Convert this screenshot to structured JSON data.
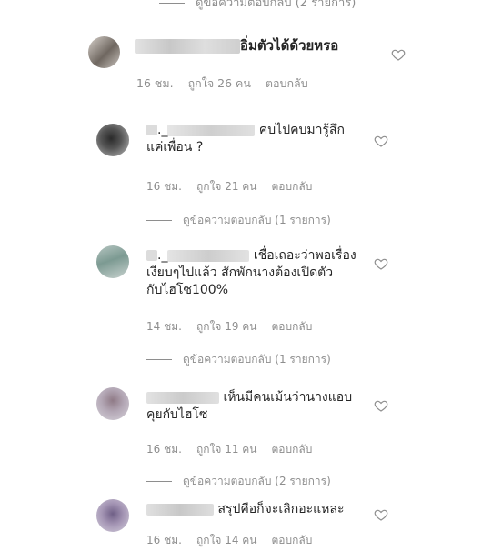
{
  "top_replies": "ดูข้อความตอบกลับ (2 รายการ)",
  "main_comment": {
    "text": "อิ่มตัวได้ด้วยหรอ",
    "time": "16 ชม.",
    "likes": "ถูกใจ 26 คน",
    "reply": "ตอบกลับ"
  },
  "comments": [
    {
      "prefix": "._",
      "text_1": " คบไปคบมารู้สึก",
      "text_2": "แค่เพื่อน ?",
      "text_3": "",
      "time": "16 ชม.",
      "likes": "ถูกใจ 21 คน",
      "reply": "ตอบกลับ",
      "view_replies": "ดูข้อความตอบกลับ (1 รายการ)"
    },
    {
      "prefix": "._",
      "text_1": " เชื่อเถอะว่าพอเรื่อง",
      "text_2": "เงียบๆไปแล้ว สักพักนางต้องเปิดตัว",
      "text_3": "กับไฮโซ100%",
      "time": "14 ชม.",
      "likes": "ถูกใจ 19 คน",
      "reply": "ตอบกลับ",
      "view_replies": "ดูข้อความตอบกลับ (1 รายการ)"
    },
    {
      "prefix": "",
      "text_1": " เห็นมีคนเม้นว่านางแอบ",
      "text_2": "คุยกับไฮโซ",
      "text_3": "",
      "time": "16 ชม.",
      "likes": "ถูกใจ 11 คน",
      "reply": "ตอบกลับ",
      "view_replies": "ดูข้อความตอบกลับ (2 รายการ)"
    },
    {
      "prefix": "",
      "text_1": " สรุปคือก็จะเลิกอะแหละ",
      "text_2": "",
      "text_3": "",
      "time": "16 ชม.",
      "likes": "ถูกใจ 14 คน",
      "reply": "ตอบกลับ",
      "view_replies": ""
    }
  ],
  "icons": {
    "like": "heart-outline-icon"
  },
  "colors": {
    "text": "#262626",
    "muted": "#8e8e8e",
    "icon": "#8e8e8e"
  }
}
